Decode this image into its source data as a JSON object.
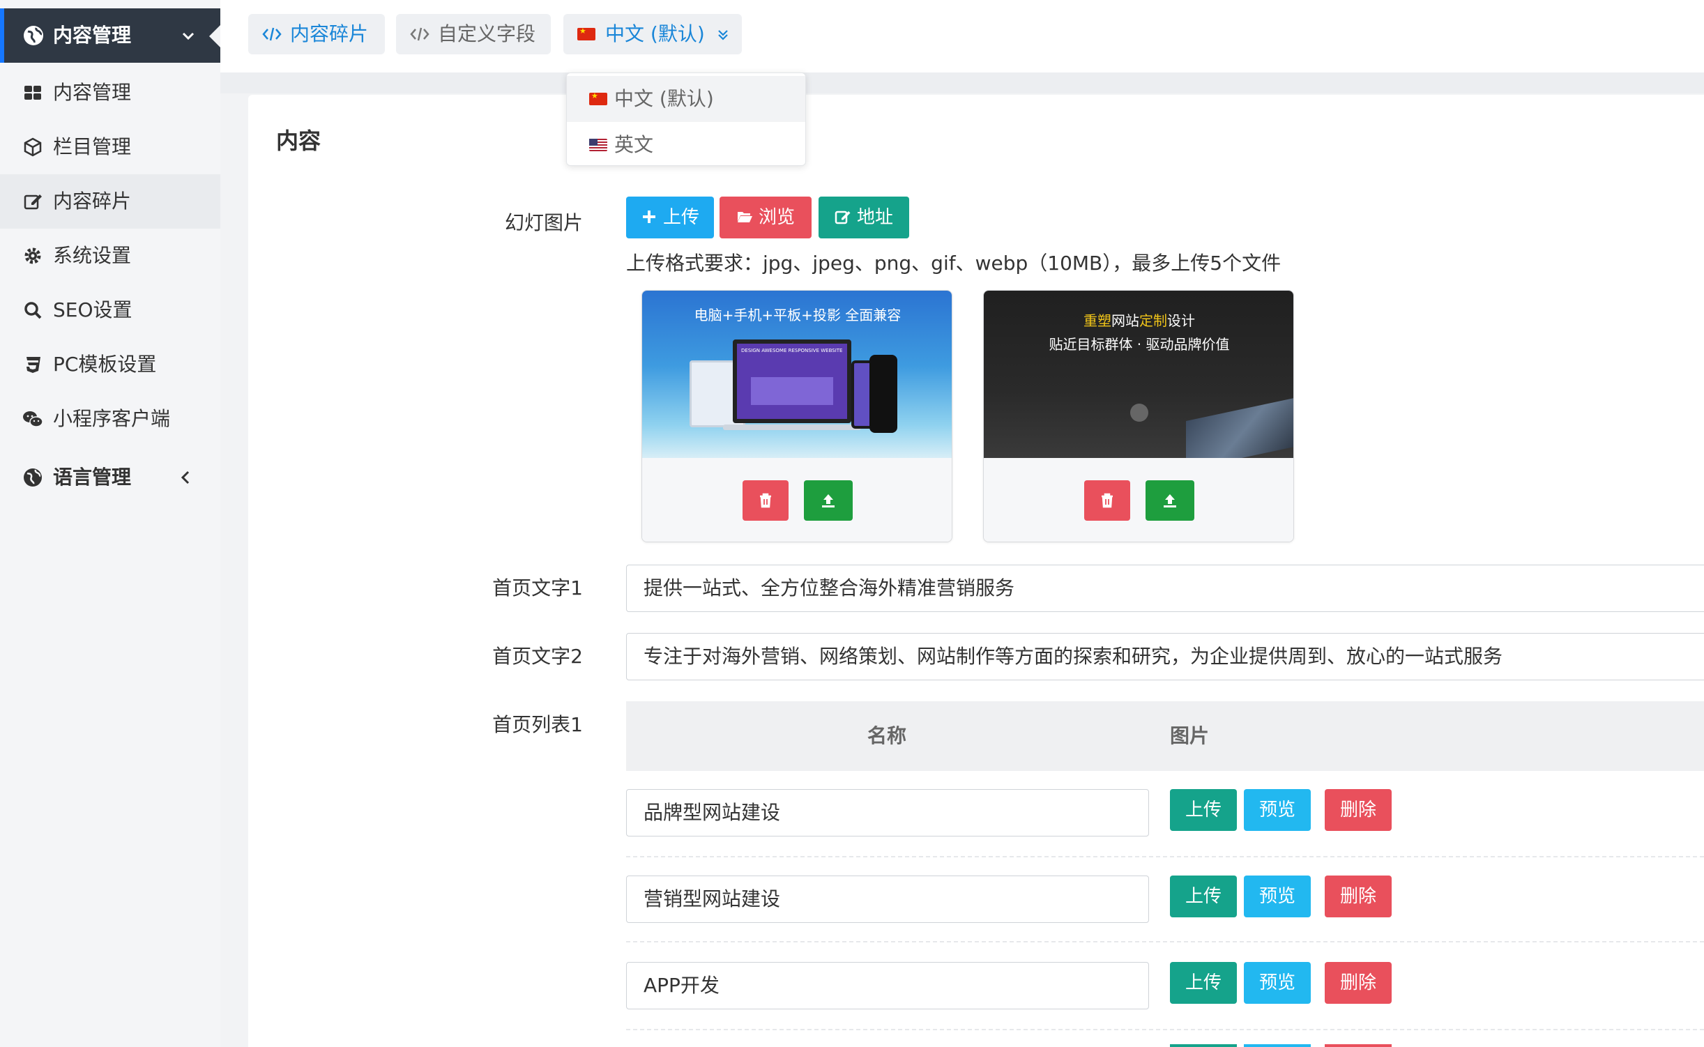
{
  "sidebar": {
    "header": {
      "label": "内容管理",
      "icon": "globe-icon"
    },
    "items": [
      {
        "label": "内容管理",
        "icon": "grid-icon"
      },
      {
        "label": "栏目管理",
        "icon": "cube-icon"
      },
      {
        "label": "内容碎片",
        "icon": "edit-icon",
        "active": true
      },
      {
        "label": "系统设置",
        "icon": "gear-icon"
      },
      {
        "label": "SEO设置",
        "icon": "search-icon"
      },
      {
        "label": "PC模板设置",
        "icon": "css3-icon"
      },
      {
        "label": "小程序客户端",
        "icon": "wechat-icon"
      },
      {
        "label": "语言管理",
        "icon": "globe-icon"
      }
    ]
  },
  "tabs": [
    {
      "label": "内容碎片",
      "icon": "code-icon"
    },
    {
      "label": "自定义字段",
      "icon": "code-icon"
    },
    {
      "label": "中文 (默认)",
      "icon": "china-flag-icon"
    }
  ],
  "language_menu": {
    "options": [
      {
        "label": "中文 (默认)",
        "flag": "china-flag-icon",
        "selected": true
      },
      {
        "label": "英文",
        "flag": "us-flag-icon",
        "selected": false
      }
    ]
  },
  "content": {
    "title": "内容",
    "slides": {
      "label": "幻灯图片",
      "buttons": {
        "upload": "上传",
        "browse": "浏览",
        "url": "地址"
      },
      "hint": "上传格式要求：jpg、jpeg、png、gif、webp（10MB），最多上传5个文件",
      "images": [
        {
          "headline": "电脑+手机+平板+投影  全面兼容",
          "screen": "DESIGN AWESOME RESPONSIVE WEBSITES"
        },
        {
          "headline_pre": "重塑",
          "headline_mid1": "网站",
          "headline_hl": "定制",
          "headline_post": "设计",
          "subline": "贴近目标群体 · 驱动品牌价值"
        }
      ]
    },
    "text1": {
      "label": "首页文字1",
      "value": "提供一站式、全方位整合海外精准营销服务"
    },
    "text2": {
      "label": "首页文字2",
      "value": "专注于对海外营销、网络策划、网站制作等方面的探索和研究，为企业提供周到、放心的一站式服务"
    },
    "list1": {
      "label": "首页列表1",
      "columns": {
        "name": "名称",
        "image": "图片"
      },
      "row_buttons": {
        "upload": "上传",
        "preview": "预览",
        "delete": "删除"
      },
      "rows": [
        {
          "name": "品牌型网站建设"
        },
        {
          "name": "营销型网站建设"
        },
        {
          "name": "APP开发"
        }
      ]
    }
  },
  "colors": {
    "sidebar_header": "#2f3844",
    "accent_blue": "#1a86d8",
    "upload_blue": "#1eaaf1",
    "danger_red": "#e9505c",
    "teal": "#15a38b",
    "green": "#1e9e3e",
    "cyan": "#22b8f0"
  }
}
